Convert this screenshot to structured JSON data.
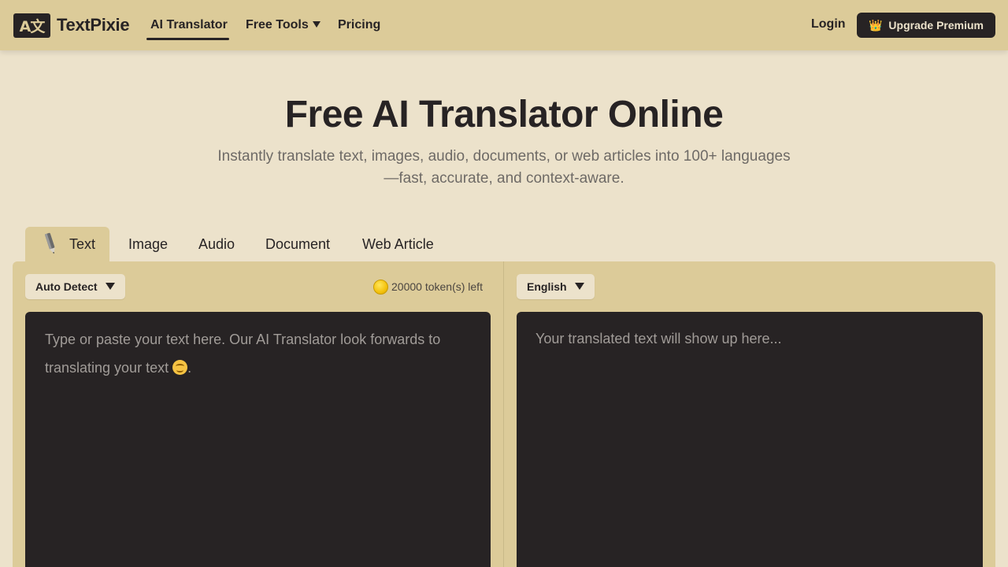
{
  "header": {
    "logo_mark": "A文",
    "logo_text": "TextPixie",
    "nav": {
      "translator": "AI Translator",
      "free_tools": "Free Tools",
      "pricing": "Pricing"
    },
    "login": "Login",
    "upgrade": "Upgrade Premium",
    "upgrade_icon": "crown-icon"
  },
  "hero": {
    "title": "Free AI Translator Online",
    "subtitle_line1": "Instantly translate text, images, audio, documents, or web articles into 100+ languages",
    "subtitle_line2": "—fast, accurate, and context-aware."
  },
  "tabs": {
    "text": "Text",
    "image": "Image",
    "audio": "Audio",
    "document": "Document",
    "web_article": "Web Article"
  },
  "translator": {
    "source_language": "Auto Detect",
    "tokens_left": "20000 token(s) left",
    "target_language": "English",
    "source_placeholder_line1": "Type or paste your text here. Our AI Translator look forwards to",
    "source_placeholder_line2": "translating your text",
    "target_placeholder": "Your translated text will show up here..."
  },
  "colors": {
    "header_bg": "#dccb99",
    "page_bg": "#ece2cb",
    "dark": "#272324"
  }
}
